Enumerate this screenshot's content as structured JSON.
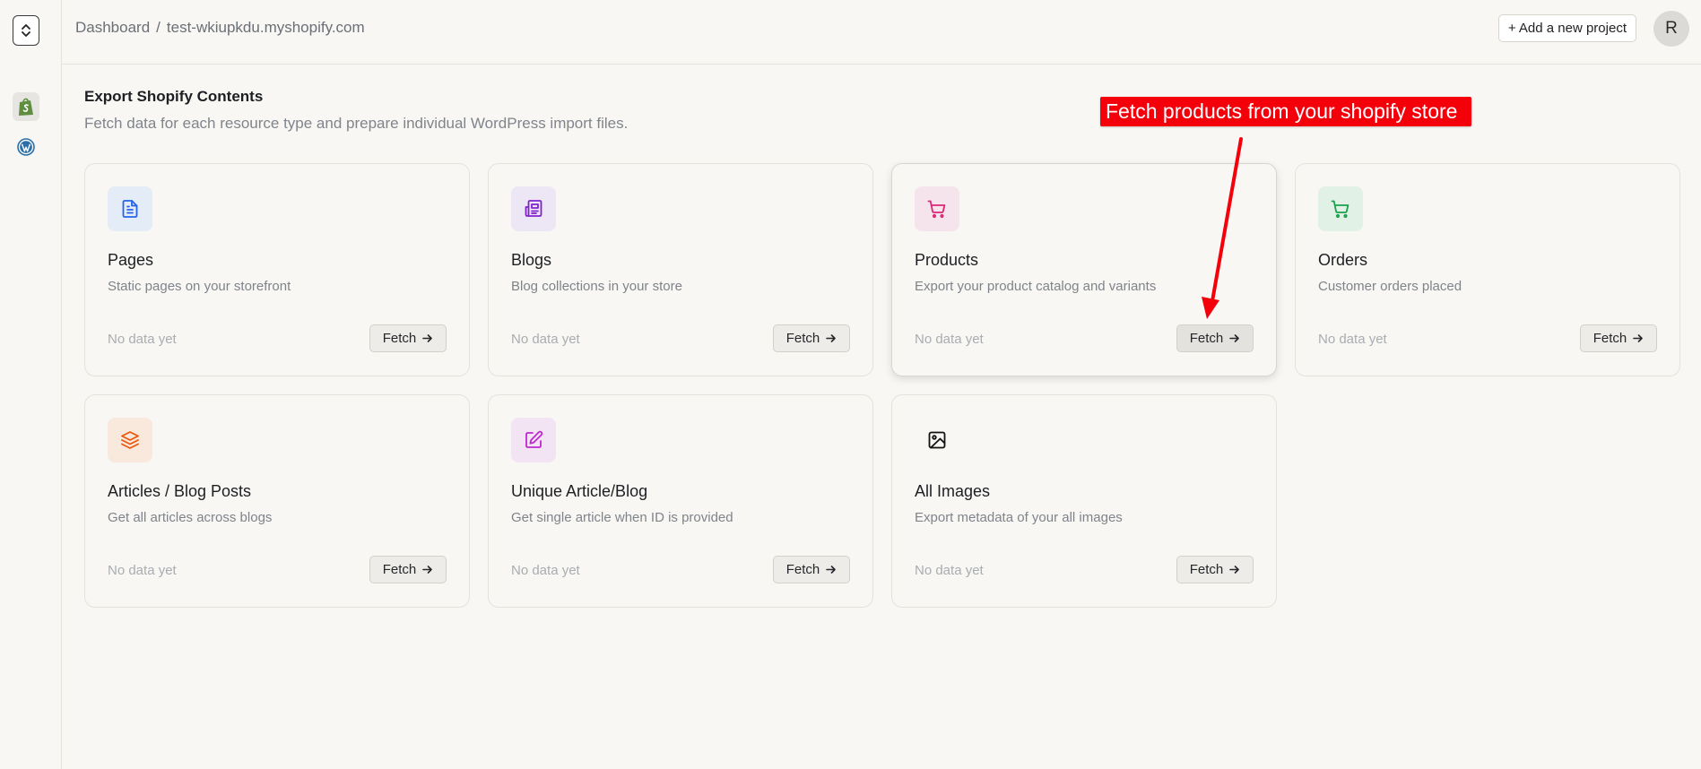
{
  "breadcrumb": {
    "root": "Dashboard",
    "separator": "/",
    "store": "test-wkiupkdu.myshopify.com"
  },
  "header": {
    "add_project_label": "+ Add a new project",
    "avatar_initial": "R"
  },
  "rail": {
    "items": [
      {
        "name": "expand-collapse",
        "icon": "chevron-up-down-icon"
      },
      {
        "name": "shopify",
        "icon": "shopify-icon"
      },
      {
        "name": "wordpress",
        "icon": "wordpress-icon"
      }
    ]
  },
  "section": {
    "title": "Export Shopify Contents",
    "subtitle": "Fetch data for each resource type and prepare individual WordPress import files."
  },
  "cards": [
    {
      "title": "Pages",
      "description": "Static pages on your storefront",
      "status": "No data yet",
      "button": "Fetch",
      "icon": "document-icon",
      "accent": "#2563eb",
      "icon_bg": "#e4ecf7"
    },
    {
      "title": "Blogs",
      "description": "Blog collections in your store",
      "status": "No data yet",
      "button": "Fetch",
      "icon": "newspaper-icon",
      "accent": "#7e22ce",
      "icon_bg": "#ede6f5"
    },
    {
      "title": "Products",
      "description": "Export your product catalog and variants",
      "status": "No data yet",
      "button": "Fetch",
      "icon": "cart-icon",
      "accent": "#db2777",
      "icon_bg": "#f6e4ec"
    },
    {
      "title": "Orders",
      "description": "Customer orders placed",
      "status": "No data yet",
      "button": "Fetch",
      "icon": "cart-icon",
      "accent": "#16a34a",
      "icon_bg": "#e2f1e6"
    },
    {
      "title": "Articles / Blog Posts",
      "description": "Get all articles across blogs",
      "status": "No data yet",
      "button": "Fetch",
      "icon": "layers-icon",
      "accent": "#ea580c",
      "icon_bg": "#f8e9dc"
    },
    {
      "title": "Unique Article/Blog",
      "description": "Get single article when ID is provided",
      "status": "No data yet",
      "button": "Fetch",
      "icon": "edit-icon",
      "accent": "#c026d3",
      "icon_bg": "#f3e4f4"
    },
    {
      "title": "All Images",
      "description": "Export metadata of your all images",
      "status": "No data yet",
      "button": "Fetch",
      "icon": "image-icon",
      "accent": "#111111",
      "icon_bg": "transparent"
    }
  ],
  "annotation": {
    "text": "Fetch products from your shopify store",
    "color": "#f4000b"
  }
}
